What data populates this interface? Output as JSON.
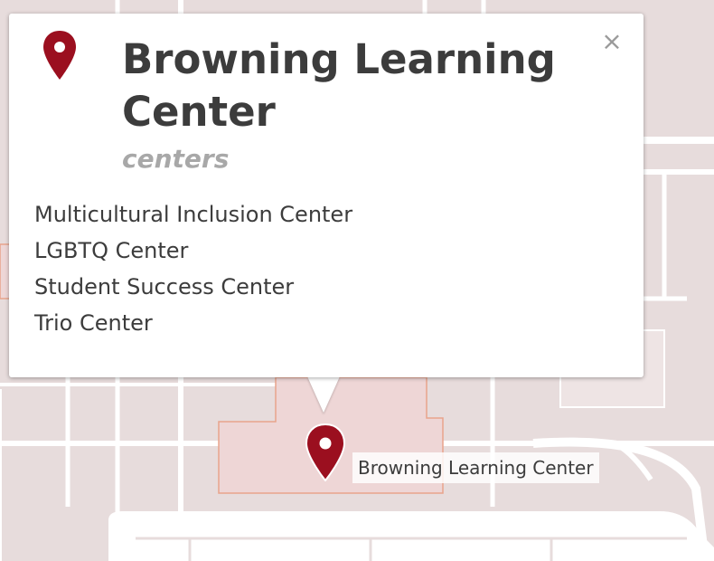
{
  "map": {
    "background_color": "#e7dcdc",
    "road_color": "#ffffff",
    "building_fill": "#eed6d6",
    "building_outline": "#e8a48c"
  },
  "popup": {
    "title": "Browning Learning Center",
    "category": "centers",
    "items": [
      "Multicultural Inclusion Center",
      "LGBTQ Center",
      "Student Success Center",
      "Trio Center"
    ],
    "close_label": "×",
    "pin_icon": "map-pin-icon",
    "pin_color": "#9b0f1f"
  },
  "marker": {
    "label": "Browning Learning Center",
    "icon": "map-pin-icon",
    "color": "#9b0f1f"
  }
}
